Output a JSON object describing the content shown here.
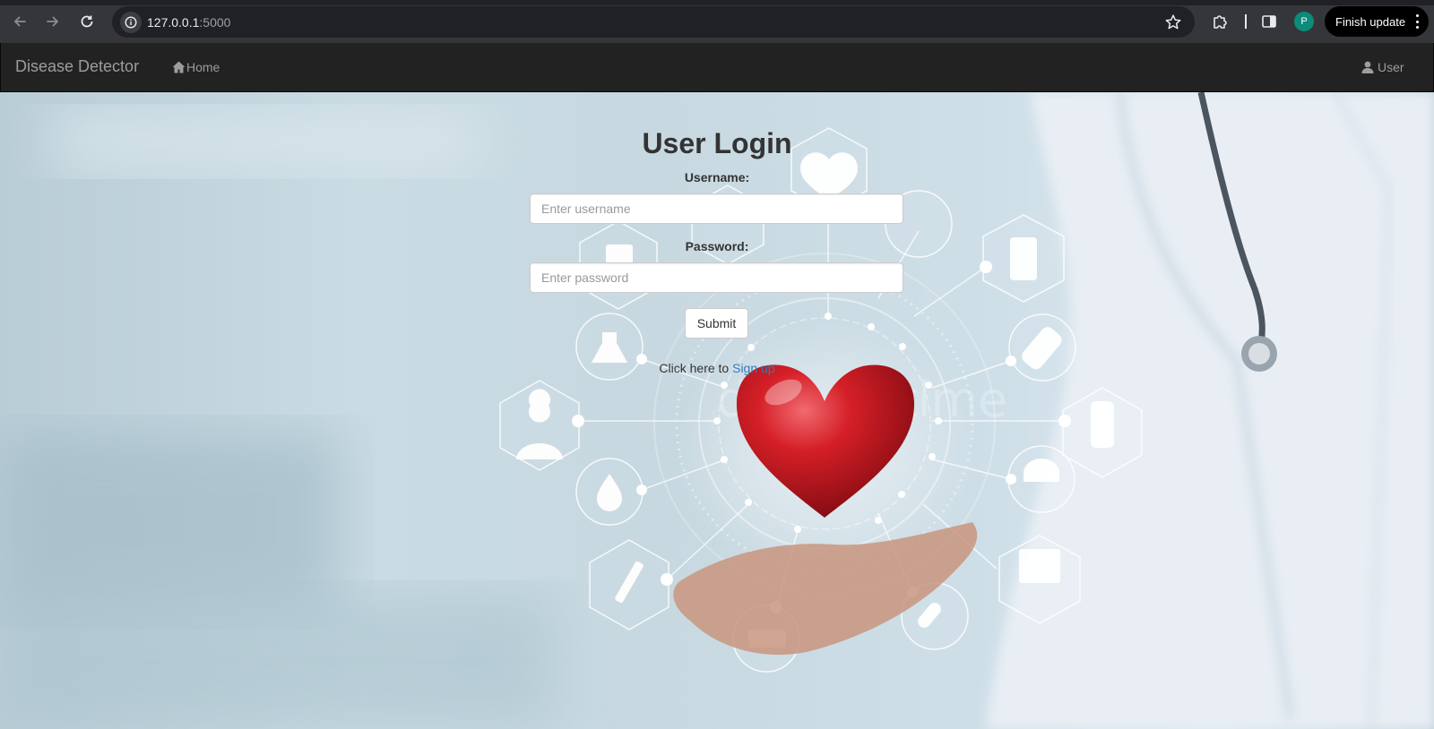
{
  "browser": {
    "url_host": "127.0.0.1",
    "url_port": ":5000",
    "profile_initial": "P",
    "finish_update_label": "Finish update"
  },
  "navbar": {
    "brand": "Disease Detector",
    "home_label": "Home",
    "user_label": "User"
  },
  "login": {
    "title": "User Login",
    "username_label": "Username:",
    "username_placeholder": "Enter username",
    "password_label": "Password:",
    "password_placeholder": "Enter password",
    "submit_label": "Submit",
    "signup_prefix": "Click here to ",
    "signup_link": "Sign up"
  },
  "background_watermark": "dreamstime",
  "icons": {
    "back": "arrow-left-icon",
    "forward": "arrow-right-icon",
    "reload": "reload-icon",
    "site_info": "info-icon",
    "bookmark": "star-icon",
    "extensions": "puzzle-icon",
    "side_panel": "side-panel-icon",
    "menu": "kebab-menu-icon",
    "home": "home-icon",
    "user": "user-icon"
  },
  "colors": {
    "navbar_bg": "#222222",
    "navbar_text": "#9d9d9d",
    "link": "#337ab7",
    "heart": "#c8161d",
    "profile": "#0b8c7a"
  }
}
